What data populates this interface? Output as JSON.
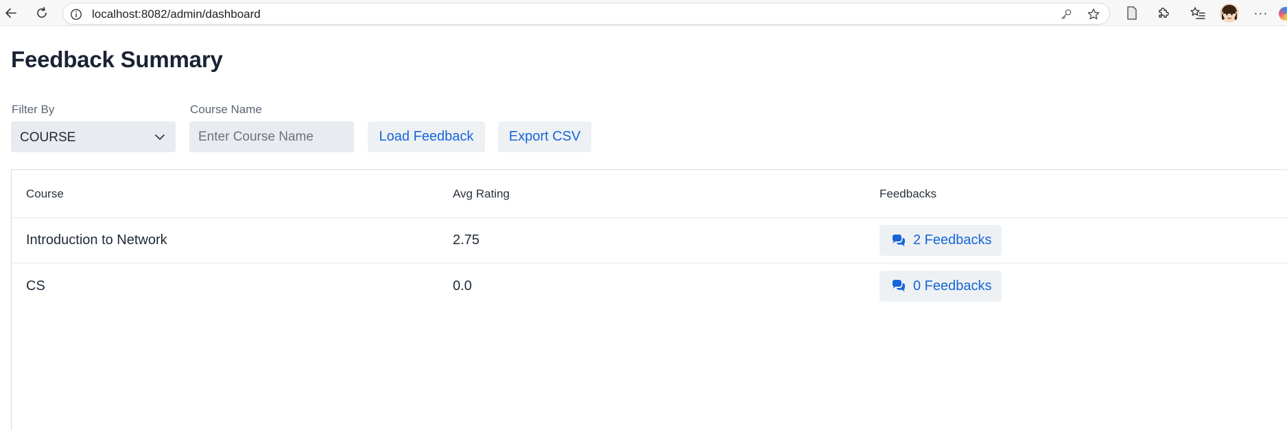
{
  "browser": {
    "url": "localhost:8082/admin/dashboard"
  },
  "page": {
    "title": "Feedback Summary"
  },
  "filters": {
    "filter_by_label": "Filter By",
    "filter_by_value": "COURSE",
    "course_name_label": "Course Name",
    "course_name_placeholder": "Enter Course Name",
    "course_name_value": ""
  },
  "actions": {
    "load_label": "Load Feedback",
    "export_label": "Export CSV"
  },
  "table": {
    "headers": [
      "Course",
      "Avg Rating",
      "Feedbacks"
    ],
    "rows": [
      {
        "course": "Introduction to Network",
        "avg_rating": "2.75",
        "feedbacks": "2 Feedbacks"
      },
      {
        "course": "CS",
        "avg_rating": "0.0",
        "feedbacks": "0 Feedbacks"
      }
    ]
  },
  "colors": {
    "accent": "#1565d8",
    "title": "#1a2233",
    "control_bg": "#e8ebef",
    "button_bg": "#eef1f4"
  },
  "icons": {
    "back": "arrow-left-icon",
    "reload": "reload-icon",
    "info": "info-icon",
    "key": "key-icon",
    "favorite": "star-icon",
    "reader": "reader-mode-icon",
    "extensions": "puzzle-icon",
    "favorites_bar": "favorites-icon",
    "more": "more-icon",
    "feedback": "comments-icon",
    "dropdown": "chevron-down-icon"
  }
}
